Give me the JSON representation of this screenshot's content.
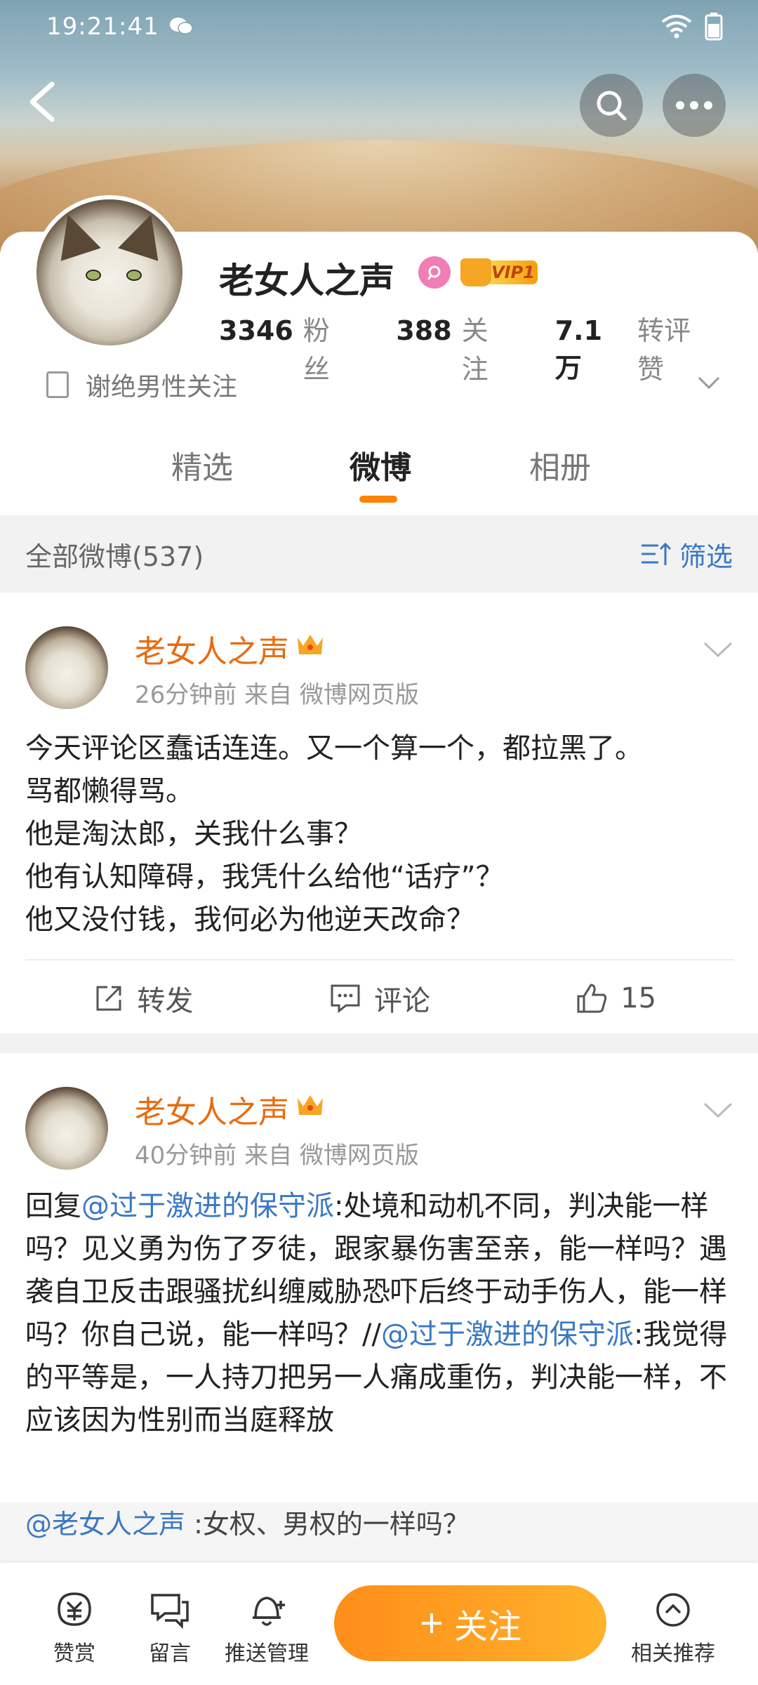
{
  "status_bar": {
    "time": "19:21:41"
  },
  "profile": {
    "name": "老女人之声",
    "vip_label": "VIP1",
    "stats": [
      {
        "value": "3346",
        "label": "粉丝"
      },
      {
        "value": "388",
        "label": "关注"
      },
      {
        "value": "7.1万",
        "label": "转评赞"
      }
    ],
    "description": "谢绝男性关注"
  },
  "tabs": [
    {
      "label": "精选",
      "active": false
    },
    {
      "label": "微博",
      "active": true
    },
    {
      "label": "相册",
      "active": false
    }
  ],
  "filter": {
    "all_label": "全部微博(537)",
    "filter_label": "筛选"
  },
  "posts": [
    {
      "author": "老女人之声",
      "meta": "26分钟前   来自 微博网页版",
      "lines": [
        "今天评论区蠢话连连。又一个算一个，都拉黑了。",
        "骂都懒得骂。",
        "他是淘汰郎，关我什么事？",
        "他有认知障碍，我凭什么给他“话疗”？",
        "他又没付钱，我何必为他逆天改命？"
      ],
      "actions": {
        "repost": "转发",
        "comment": "评论",
        "like": "15"
      }
    },
    {
      "author": "老女人之声",
      "meta": "40分钟前   来自 微博网页版",
      "reply_prefix": "回复",
      "mention": "@过于激进的保守派",
      "body_1": ":处境和动机不同，判决能一样吗？见义勇为伤了歹徒，跟家暴伤害至亲，能一样吗？遇袭自卫反击跟骚扰纠缠威胁恐吓后终于动手伤人，能一样吗？你自己说，能一样吗？//",
      "mention_2": "@过于激进的保守派",
      "body_2": ":我觉得的平等是，一人持刀把另一人痛成重伤，判决能一样，不应该因为性别而当庭释放",
      "quote_mention": "@老女人之声",
      "quote_text": " :女权、男权的一样吗？"
    }
  ],
  "bottom_bar": {
    "reward": "赞赏",
    "message": "留言",
    "push": "推送管理",
    "follow": "关注",
    "related": "相关推荐"
  },
  "colors": {
    "accent": "#ff8200",
    "link": "#3a78c3",
    "author": "#e86b0e"
  }
}
